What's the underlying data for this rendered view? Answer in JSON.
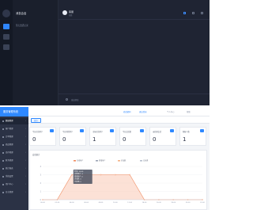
{
  "top_app": {
    "sidebar_title": "消息会话",
    "list_item": "暂无会话记录",
    "chat_name": "客服",
    "chat_status": "在线",
    "input_label": "发送消息"
  },
  "dashboard": {
    "brand": "服务管理系统",
    "nav": [
      {
        "label": "数据管理",
        "active": true
      },
      {
        "label": "客户管理"
      },
      {
        "label": "订单管理"
      },
      {
        "label": "商品管理"
      },
      {
        "label": "库存管理"
      },
      {
        "label": "财务管理"
      },
      {
        "label": "统计报表"
      },
      {
        "label": "系统设置"
      },
      {
        "label": "用户中心"
      },
      {
        "label": "日志管理"
      }
    ],
    "topbar_links": [
      "修改密码",
      "退出登录",
      "个人中心",
      "帮助"
    ],
    "tab": "首页",
    "cards": [
      {
        "title": "今日在线用户",
        "value": "0"
      },
      {
        "title": "今日新增用户",
        "value": "0"
      },
      {
        "title": "当前在线用户",
        "value": "1"
      },
      {
        "title": "今日会话数",
        "value": "0"
      },
      {
        "title": "未处理会话",
        "value": "0"
      },
      {
        "title": "客服人数",
        "value": "1"
      }
    ],
    "chart_panel_title": "会话统计"
  },
  "colors": {
    "accent": "#2e88ff",
    "dark_bg": "#1f2433",
    "sidebar_bg": "#2b3245",
    "series_fill": "#f9c8b4",
    "series_line": "#f08a5d"
  },
  "chart_data": {
    "type": "area",
    "title": "",
    "legend": [
      "在线用户",
      "新增用户",
      "会话数",
      "已处理"
    ],
    "legend_position": "top",
    "x": [
      "00:00",
      "02:00",
      "04:00",
      "06:00",
      "08:00",
      "10:00",
      "12:00",
      "14:00",
      "16:00",
      "18:00",
      "20:00",
      "22:00"
    ],
    "series": [
      {
        "name": "在线用户",
        "values": [
          0,
          0,
          3,
          3,
          3,
          3,
          3,
          0,
          0,
          0,
          0,
          0
        ]
      }
    ],
    "ylim": [
      0,
      4
    ],
    "y_ticks": [
      "0",
      "1",
      "2",
      "3",
      "4"
    ],
    "tooltip": [
      "时间: 10:00",
      "在线用户: 3",
      "新增用户: 0",
      "会话数: 0",
      "已处理: 0"
    ],
    "grid": true
  }
}
